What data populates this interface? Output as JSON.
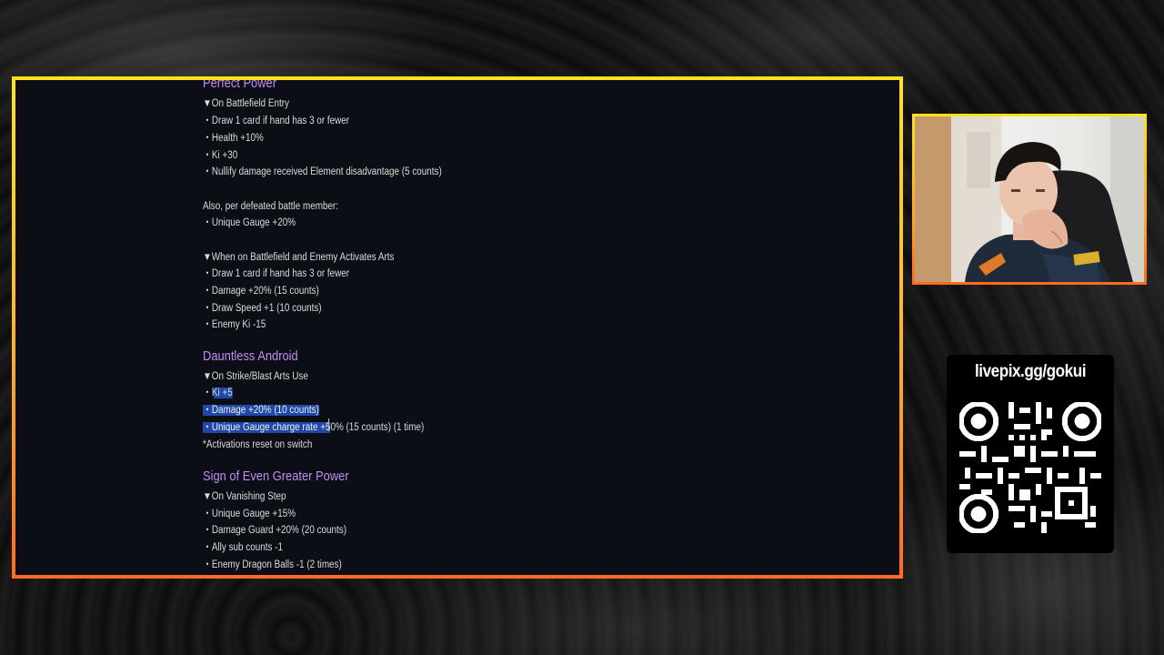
{
  "document": {
    "sections": [
      {
        "title": "Perfect Power",
        "lines": [
          "▼On Battlefield Entry",
          "・Draw 1 card if hand has 3 or fewer",
          "・Health +10%",
          "・Ki +30",
          "・Nullify damage received Element disadvantage (5 counts)",
          "",
          "Also, per defeated battle member:",
          "・Unique Gauge +20%",
          "",
          "▼When on Battlefield and Enemy Activates Arts",
          "・Draw 1 card if hand has 3 or fewer",
          "・Damage +20% (15 counts)",
          "・Draw Speed +1 (10 counts)",
          "・Enemy Ki -15"
        ]
      },
      {
        "title": "Dauntless Android",
        "lines": [
          "▼On Strike/Blast Arts Use",
          "・Ki +5",
          "・Damage +20% (10 counts)",
          "・Unique Gauge charge rate +50% (15 counts) (1 time)",
          "*Activations reset on switch"
        ]
      },
      {
        "title": "Sign of Even Greater Power",
        "lines": [
          "▼On Vanishing Step",
          "・Unique Gauge +15%",
          "・Damage Guard +20% (20 counts)",
          "・Ally sub counts -1",
          "・Enemy Dragon Balls -1 (2 times)"
        ]
      }
    ],
    "selection": {
      "line_ki": "・Ki +5",
      "line_damage": "・Damage +20% (10 counts)",
      "line_gauge_selected": "・Unique Gauge charge rate +5",
      "line_gauge_rest": "0% (15 counts) (1 time)"
    }
  },
  "overlay": {
    "qr_url": "livepix.gg/gokui"
  },
  "colors": {
    "frame_top": "#ffe21a",
    "frame_bottom": "#ff6a1e",
    "heading": "#c58cf4",
    "selection": "#1f48a8",
    "screen_bg": "#0b0e14"
  }
}
